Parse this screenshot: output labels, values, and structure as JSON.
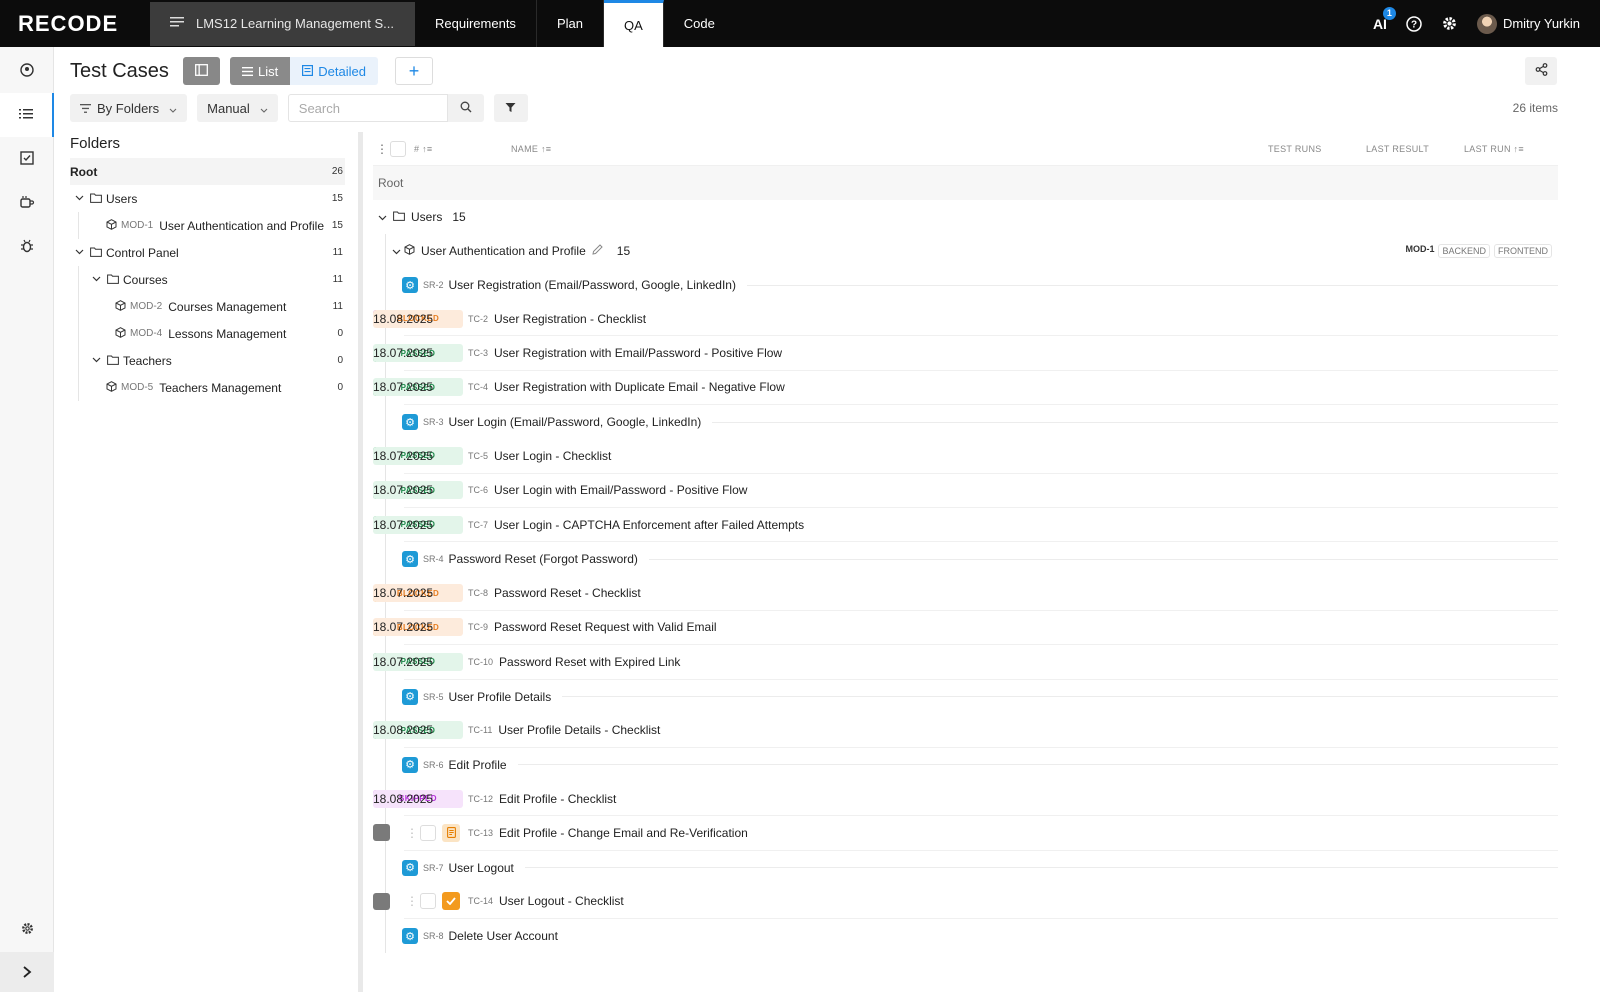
{
  "app": {
    "logo": "RECODE",
    "project_title": "LMS12 Learning Management S...",
    "nav_tabs": [
      "Requirements",
      "Plan",
      "QA",
      "Code"
    ],
    "active_tab": "QA"
  },
  "topbar": {
    "ai_label": "AI",
    "ai_badge": "1",
    "user_name": "Dmitry Yurkin"
  },
  "header": {
    "title": "Test Cases",
    "view_list": "List",
    "view_detailed": "Detailed",
    "add": "+"
  },
  "toolbar": {
    "group_by": "By Folders",
    "type": "Manual",
    "search_placeholder": "Search",
    "items_count": "26 items"
  },
  "folders": {
    "title": "Folders",
    "root": {
      "label": "Root",
      "count": "26"
    },
    "users": {
      "label": "Users",
      "count": "15"
    },
    "mod1": {
      "code": "MOD-1",
      "label": "User Authentication and Profile",
      "count": "15"
    },
    "control_panel": {
      "label": "Control Panel",
      "count": "11"
    },
    "courses": {
      "label": "Courses",
      "count": "11"
    },
    "mod2": {
      "code": "MOD-2",
      "label": "Courses Management",
      "count": "11"
    },
    "mod4": {
      "code": "MOD-4",
      "label": "Lessons Management",
      "count": "0"
    },
    "teachers": {
      "label": "Teachers",
      "count": "0"
    },
    "mod5": {
      "code": "MOD-5",
      "label": "Teachers Management",
      "count": "0"
    }
  },
  "table": {
    "headers": {
      "num": "#",
      "name": "NAME",
      "runs": "TEST RUNS",
      "result": "LAST RESULT",
      "lastrun": "LAST RUN"
    },
    "root_label": "Root",
    "group": {
      "label": "Users",
      "count": "15"
    },
    "module": {
      "label": "User Authentication and Profile",
      "count": "15",
      "code": "MOD-1",
      "tags": [
        "BACKEND",
        "FRONTEND"
      ]
    },
    "outdated_label": "OUTDATED",
    "colors": {
      "green": "#1f9d4c",
      "orange": "#f7941d",
      "purple": "#b72ae0",
      "grey": "#7a7a7a"
    },
    "sr": [
      {
        "code": "SR-2",
        "title": "User Registration (Email/Password, Google, LinkedIn)"
      },
      {
        "code": "SR-3",
        "title": "User Login (Email/Password, Google, LinkedIn)"
      },
      {
        "code": "SR-4",
        "title": "Password Reset (Forgot Password)"
      },
      {
        "code": "SR-5",
        "title": "User Profile Details"
      },
      {
        "code": "SR-6",
        "title": "Edit Profile"
      },
      {
        "code": "SR-7",
        "title": "User Logout"
      },
      {
        "code": "SR-8",
        "title": "Delete User Account"
      }
    ],
    "tc": [
      {
        "code": "TC-2",
        "name": "User Registration - Checklist",
        "type": "checklist",
        "outdated": false,
        "runs": [
          "purple",
          "orange"
        ],
        "result": "BLOCKED",
        "lastrun": "18.08.2025"
      },
      {
        "code": "TC-3",
        "name": "User Registration with Email/Password - Positive Flow",
        "type": "doc",
        "outdated": false,
        "runs": [
          "green"
        ],
        "result": "PASSED",
        "lastrun": "18.07.2025"
      },
      {
        "code": "TC-4",
        "name": "User Registration with Duplicate Email - Negative Flow",
        "type": "doc",
        "outdated": false,
        "runs": [
          "green"
        ],
        "result": "PASSED",
        "lastrun": "18.07.2025"
      },
      {
        "code": "TC-5",
        "name": "User Login - Checklist",
        "type": "checklist",
        "outdated": false,
        "runs": [
          "green"
        ],
        "result": "PASSED",
        "lastrun": "18.07.2025"
      },
      {
        "code": "TC-6",
        "name": "User Login with Email/Password - Positive Flow",
        "type": "doc",
        "outdated": false,
        "runs": [
          "green"
        ],
        "result": "PASSED",
        "lastrun": "18.07.2025"
      },
      {
        "code": "TC-7",
        "name": "User Login - CAPTCHA Enforcement after Failed Attempts",
        "type": "doc",
        "outdated": false,
        "runs": [
          "green"
        ],
        "result": "PASSED",
        "lastrun": "18.07.2025"
      },
      {
        "code": "TC-8",
        "name": "Password Reset - Checklist",
        "type": "checklist",
        "outdated": true,
        "runs": [
          "orange"
        ],
        "result": "BLOCKED",
        "lastrun": "18.07.2025"
      },
      {
        "code": "TC-9",
        "name": "Password Reset Request with Valid Email",
        "type": "doc",
        "outdated": true,
        "runs": [
          "orange"
        ],
        "result": "BLOCKED",
        "lastrun": "18.07.2025"
      },
      {
        "code": "TC-10",
        "name": "Password Reset with Expired Link",
        "type": "doc",
        "outdated": true,
        "runs": [
          "green"
        ],
        "result": "PASSED",
        "lastrun": "18.07.2025"
      },
      {
        "code": "TC-11",
        "name": "User Profile Details - Checklist",
        "type": "checklist",
        "outdated": true,
        "runs": [
          "green"
        ],
        "result": "PASSED",
        "lastrun": "18.08.2025"
      },
      {
        "code": "TC-12",
        "name": "Edit Profile - Checklist",
        "type": "checklist",
        "outdated": false,
        "runs": [
          "purple"
        ],
        "result": "SKIPPED",
        "lastrun": "18.08.2025"
      },
      {
        "code": "TC-13",
        "name": "Edit Profile - Change Email and Re-Verification",
        "type": "doc",
        "outdated": false,
        "runs": [
          "grey"
        ],
        "result": "",
        "lastrun": ""
      },
      {
        "code": "TC-14",
        "name": "User Logout - Checklist",
        "type": "checklist",
        "outdated": false,
        "runs": [
          "grey"
        ],
        "result": "",
        "lastrun": ""
      }
    ]
  }
}
